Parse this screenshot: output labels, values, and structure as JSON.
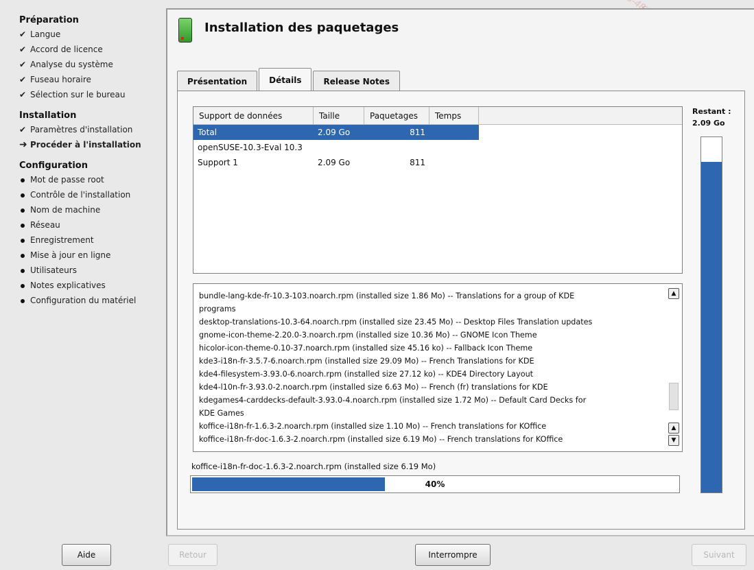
{
  "sidebar": {
    "sections": [
      {
        "title": "Préparation",
        "items": [
          {
            "label": "Langue",
            "state": "done"
          },
          {
            "label": "Accord de licence",
            "state": "done"
          },
          {
            "label": "Analyse du système",
            "state": "done"
          },
          {
            "label": "Fuseau horaire",
            "state": "done"
          },
          {
            "label": "Sélection sur le bureau",
            "state": "done"
          }
        ]
      },
      {
        "title": "Installation",
        "items": [
          {
            "label": "Paramètres d'installation",
            "state": "done"
          },
          {
            "label": "Procéder à l'installation",
            "state": "current"
          }
        ]
      },
      {
        "title": "Configuration",
        "items": [
          {
            "label": "Mot de passe root",
            "state": "todo"
          },
          {
            "label": "Contrôle de l'installation",
            "state": "todo"
          },
          {
            "label": "Nom de machine",
            "state": "todo"
          },
          {
            "label": "Réseau",
            "state": "todo"
          },
          {
            "label": "Enregistrement",
            "state": "todo"
          },
          {
            "label": "Mise à jour en ligne",
            "state": "todo"
          },
          {
            "label": "Utilisateurs",
            "state": "todo"
          },
          {
            "label": "Notes explicatives",
            "state": "todo"
          },
          {
            "label": "Configuration du matériel",
            "state": "todo"
          }
        ]
      }
    ]
  },
  "main": {
    "title": "Installation des paquetages",
    "tabs": [
      {
        "label": "Présentation",
        "active": false
      },
      {
        "label": "Détails",
        "active": true
      },
      {
        "label": "Release Notes",
        "active": false
      }
    ],
    "media_table": {
      "headers": [
        "Support de données",
        "Taille",
        "Paquetages",
        "Temps"
      ],
      "rows": [
        {
          "name": "Total",
          "size": "2.09 Go",
          "packages": "811",
          "time": "",
          "selected": true
        },
        {
          "name": "openSUSE-10.3-Eval 10.3",
          "size": "",
          "packages": "",
          "time": "",
          "selected": false
        },
        {
          "name": "Support 1",
          "size": "2.09 Go",
          "packages": "811",
          "time": "",
          "selected": false
        }
      ]
    },
    "remaining": {
      "label": "Restant :",
      "value": "2.09 Go",
      "fraction": 0.93
    },
    "log_lines": [
      "bundle-lang-kde-fr-10.3-103.noarch.rpm (installed size 1.86 Mo) -- Translations for a group of KDE",
      "programs",
      "desktop-translations-10.3-64.noarch.rpm (installed size 23.45 Mo) -- Desktop Files Translation updates",
      "gnome-icon-theme-2.20.0-3.noarch.rpm (installed size 10.36 Mo) -- GNOME Icon Theme",
      "hicolor-icon-theme-0.10-37.noarch.rpm (installed size 45.16 ko) -- Fallback Icon Theme",
      "kde3-i18n-fr-3.5.7-6.noarch.rpm (installed size 29.09 Mo) -- French Translations for KDE",
      "kde4-filesystem-3.93.0-6.noarch.rpm (installed size 27.12 ko) -- KDE4 Directory Layout",
      "kde4-l10n-fr-3.93.0-2.noarch.rpm (installed size 6.63 Mo) -- French (fr) translations for KDE",
      "kdegames4-carddecks-default-3.93.0-4.noarch.rpm (installed size 1.72 Mo) -- Default Card Decks for",
      "KDE Games",
      "koffice-i18n-fr-1.6.3-2.noarch.rpm (installed size 1.10 Mo) -- French translations for KOffice",
      "koffice-i18n-fr-doc-1.6.3-2.noarch.rpm (installed size 6.19 Mo) -- French translations for KOffice"
    ],
    "current_package": "koffice-i18n-fr-doc-1.6.3-2.noarch.rpm (installed size 6.19 Mo)",
    "progress": {
      "percent": 40,
      "text": "40%"
    }
  },
  "buttons": {
    "help": "Aide",
    "back": "Retour",
    "abort": "Interrompre",
    "next": "Suivant"
  },
  "colors": {
    "accent": "#2e67b1",
    "background": "#e9e9e9"
  }
}
